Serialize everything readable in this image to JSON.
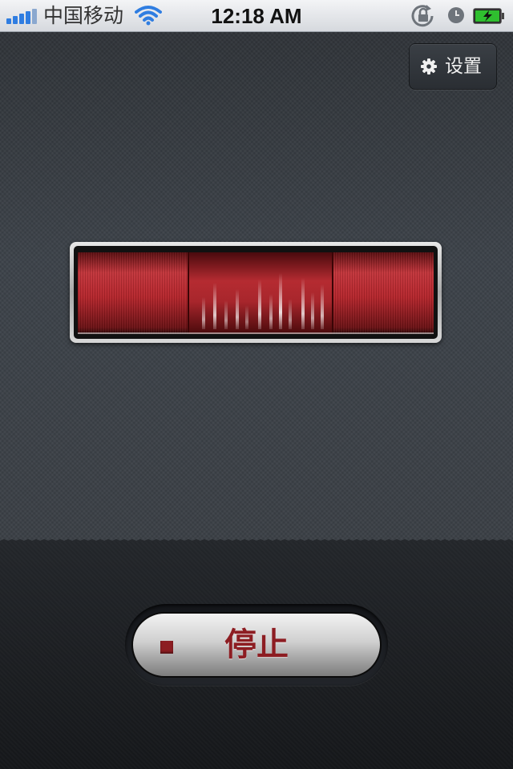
{
  "status_bar": {
    "carrier": "中国移动",
    "time": "12:18 AM",
    "signal_bars": 5,
    "battery_state": "charging",
    "icons": [
      "signal-icon",
      "wifi-icon",
      "rotation-lock-icon",
      "alarm-clock-icon",
      "battery-charging-icon"
    ]
  },
  "toolbar": {
    "settings_label": "设置",
    "settings_icon": "gear-icon"
  },
  "meter": {
    "accent_color": "#b4232a"
  },
  "controls": {
    "stop_label": "停止",
    "stop_icon": "stop-square-icon",
    "stop_color": "#8d1d22"
  }
}
